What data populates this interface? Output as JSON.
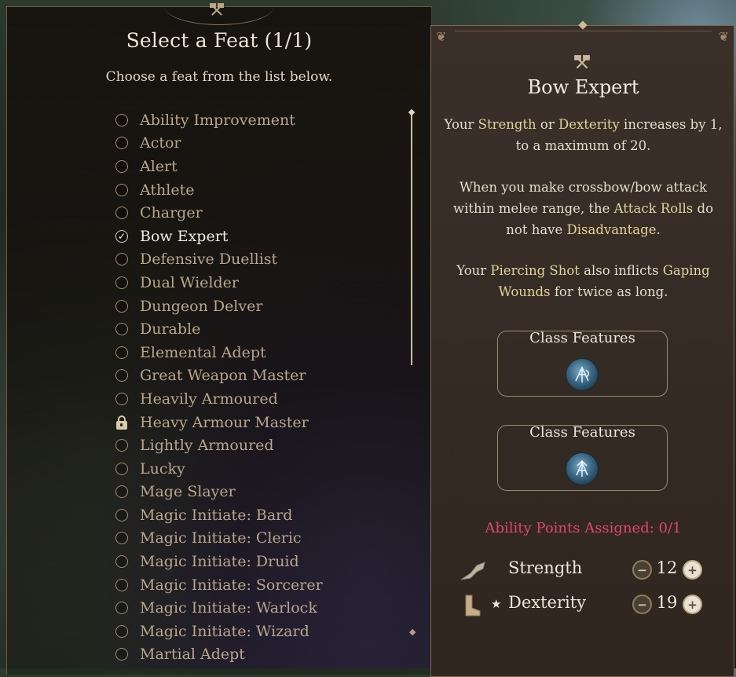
{
  "left_panel": {
    "title": "Select a Feat (1/1)",
    "subtitle": "Choose a feat from the list below.",
    "feats": [
      {
        "label": "Ability Improvement",
        "state": "unselected"
      },
      {
        "label": "Actor",
        "state": "unselected"
      },
      {
        "label": "Alert",
        "state": "unselected"
      },
      {
        "label": "Athlete",
        "state": "unselected"
      },
      {
        "label": "Charger",
        "state": "unselected"
      },
      {
        "label": "Bow Expert",
        "state": "selected"
      },
      {
        "label": "Defensive Duellist",
        "state": "unselected"
      },
      {
        "label": "Dual Wielder",
        "state": "unselected"
      },
      {
        "label": "Dungeon Delver",
        "state": "unselected"
      },
      {
        "label": "Durable",
        "state": "unselected"
      },
      {
        "label": "Elemental Adept",
        "state": "unselected"
      },
      {
        "label": "Great Weapon Master",
        "state": "unselected"
      },
      {
        "label": "Heavily Armoured",
        "state": "unselected"
      },
      {
        "label": "Heavy Armour Master",
        "state": "locked"
      },
      {
        "label": "Lightly Armoured",
        "state": "unselected"
      },
      {
        "label": "Lucky",
        "state": "unselected"
      },
      {
        "label": "Mage Slayer",
        "state": "unselected"
      },
      {
        "label": "Magic Initiate: Bard",
        "state": "unselected"
      },
      {
        "label": "Magic Initiate: Cleric",
        "state": "unselected"
      },
      {
        "label": "Magic Initiate: Druid",
        "state": "unselected"
      },
      {
        "label": "Magic Initiate: Sorcerer",
        "state": "unselected"
      },
      {
        "label": "Magic Initiate: Warlock",
        "state": "unselected"
      },
      {
        "label": "Magic Initiate: Wizard",
        "state": "unselected"
      },
      {
        "label": "Martial Adept",
        "state": "unselected"
      }
    ],
    "checkmark_glyph": "✓"
  },
  "detail": {
    "title": "Bow Expert",
    "icon": "crossed-hammers-icon",
    "para1": [
      "Your ",
      "Strength",
      " or ",
      "Dexterity",
      " increases by 1, to a maximum of 20."
    ],
    "para2": [
      "When you make crossbow/bow attack within melee range, the ",
      "Attack Rolls",
      " do not have ",
      "Disadvantage",
      "."
    ],
    "para3": [
      "Your ",
      "Piercing Shot",
      " also inflicts ",
      "Gaping Wounds",
      " for twice as long."
    ],
    "class_features": [
      {
        "label": "Class Features",
        "icon": "ranger-class-icon-1"
      },
      {
        "label": "Class Features",
        "icon": "ranger-class-icon-2"
      }
    ],
    "ability_points": "Ability Points Assigned:  0/1",
    "abilities": [
      {
        "name": "Strength",
        "value": "12",
        "starred": false,
        "icon": "strength-arm-icon"
      },
      {
        "name": "Dexterity",
        "value": "19",
        "starred": true,
        "icon": "dexterity-boot-icon"
      }
    ],
    "minus_glyph": "−",
    "plus_glyph": "+",
    "star_glyph": "★"
  },
  "colors": {
    "highlight_keyword": "#e3d398",
    "ability_points_text": "#e0456d",
    "panel_border": "#7e6b4e"
  }
}
